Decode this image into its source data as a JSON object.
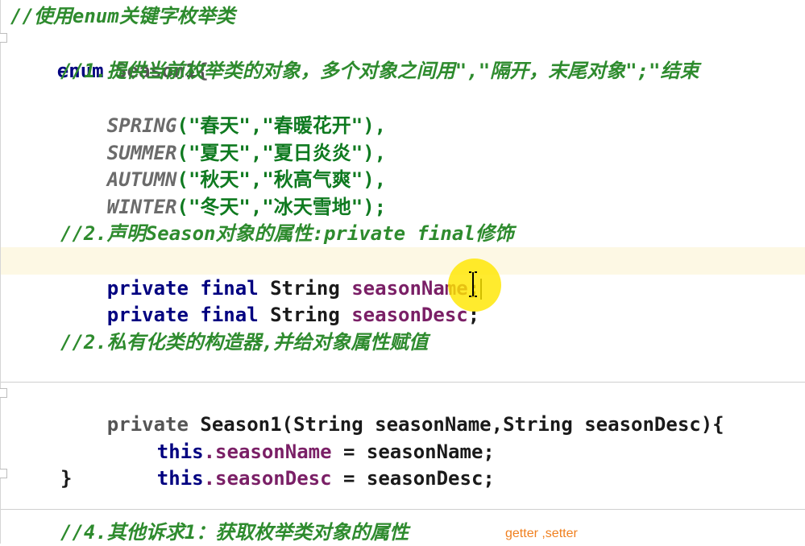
{
  "editor": {
    "comment_enum": "//使用enum关键字枚举类",
    "enum_keyword": "enum",
    "enum_declaration": " Season1{",
    "comment_1": "//1.提供当前枚举类的对象，多个对象之间用\",\"隔开，末尾对象\";\"结束",
    "constants": [
      {
        "name": "SPRING",
        "args": "(\"春天\",\"春暖花开\"),",
        "desc": "春暖花开"
      },
      {
        "name": "SUMMER",
        "args": "(\"夏天\",\"夏日炎炎\"),",
        "desc": "夏日炎炎"
      },
      {
        "name": "AUTUMN",
        "args": "(\"秋天\",\"秋高气爽\"),",
        "desc": "秋高气爽"
      },
      {
        "name": "WINTER",
        "args": "(\"冬天\",\"冰天雪地\");",
        "desc": "冰天雪地"
      }
    ],
    "comment_2": "//2.声明Season对象的属性:private final修饰",
    "field_modifiers": "private final",
    "field_type": " String ",
    "field1_name": "seasonName",
    "field2_name": "seasonDesc",
    "semicolon": ";",
    "comment_3": "//2.私有化类的构造器,并给对象属性赋值",
    "ctor_private": "private",
    "ctor_signature": " Season1(String seasonName,String seasonDesc){",
    "this_kw": "this",
    "assign1_field": ".seasonName",
    "assign1_rest": " = seasonName;",
    "assign2_field": ".seasonDesc",
    "assign2_rest": " = seasonDesc;",
    "closing_brace": "}",
    "comment_4": "//4.其他诉求1：获取枚举类对象的属性"
  },
  "annotation": {
    "text": "getter ,setter",
    "color": "#f08020"
  },
  "colors": {
    "keyword": "#000080",
    "comment": "#2e8b2e",
    "string": "#0f7a20",
    "field": "#7a1f66",
    "constant": "#6b6b6b",
    "current_line": "#fdf8e4",
    "cursor_highlight": "#ffe600"
  }
}
